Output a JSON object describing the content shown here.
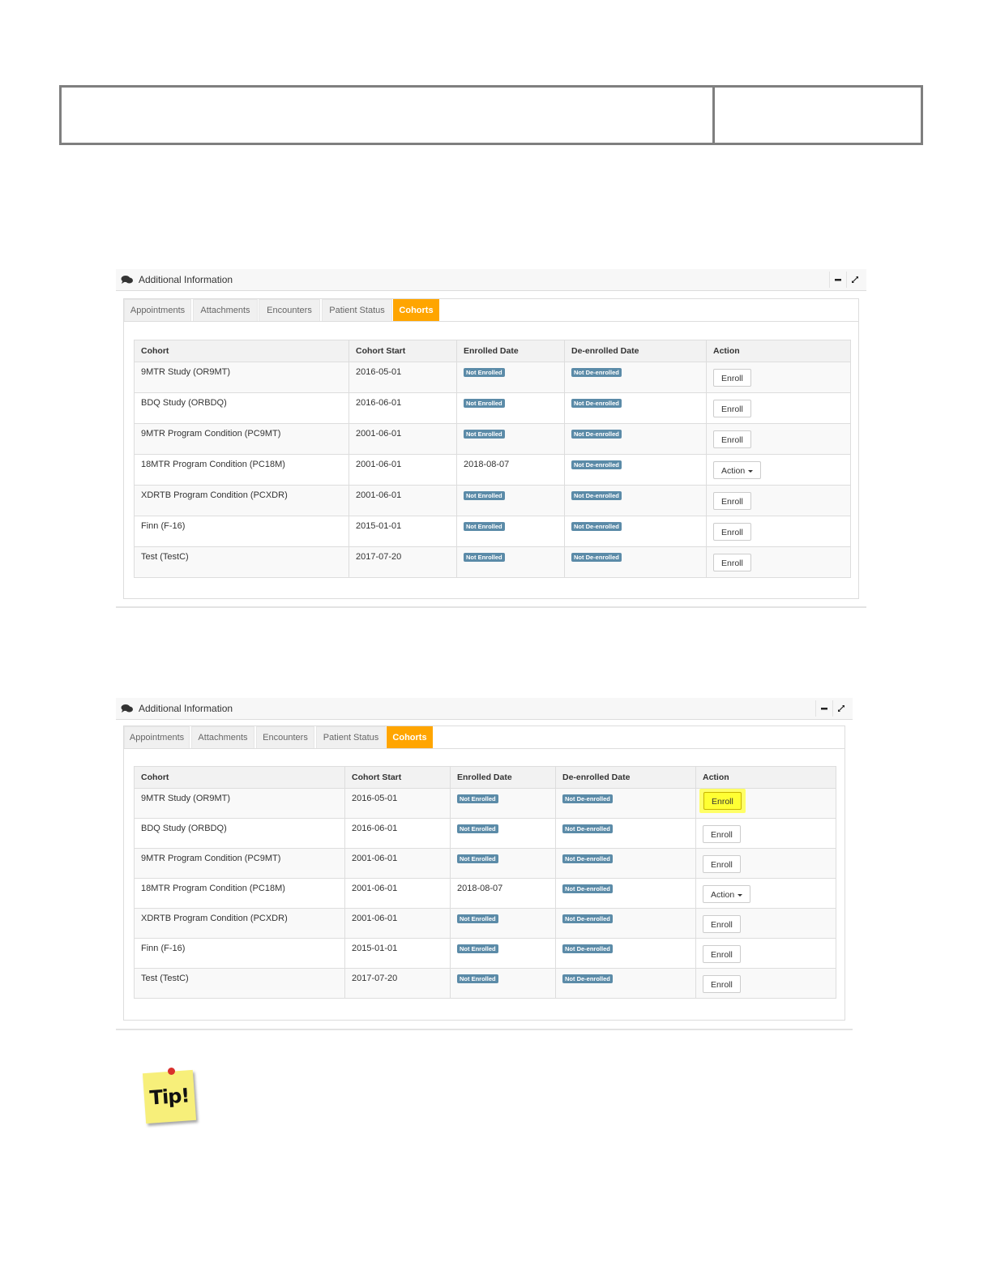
{
  "panel_title": "Additional Information",
  "tabs": [
    "Appointments",
    "Attachments",
    "Encounters",
    "Patient Status",
    "Cohorts"
  ],
  "active_tab": "Cohorts",
  "columns": [
    "Cohort",
    "Cohort Start",
    "Enrolled Date",
    "De-enrolled Date",
    "Action"
  ],
  "rows": [
    {
      "cohort": "9MTR Study (OR9MT)",
      "start": "2016-05-01",
      "enrolled": "Not Enrolled",
      "deenrolled": "Not De-enrolled",
      "action": "Enroll"
    },
    {
      "cohort": "BDQ Study (ORBDQ)",
      "start": "2016-06-01",
      "enrolled": "Not Enrolled",
      "deenrolled": "Not De-enrolled",
      "action": "Enroll"
    },
    {
      "cohort": "9MTR Program Condition (PC9MT)",
      "start": "2001-06-01",
      "enrolled": "Not Enrolled",
      "deenrolled": "Not De-enrolled",
      "action": "Enroll"
    },
    {
      "cohort": "18MTR Program Condition (PC18M)",
      "start": "2001-06-01",
      "enrolled": "2018-08-07",
      "deenrolled": "Not De-enrolled",
      "action": "Action"
    },
    {
      "cohort": "XDRTB Program Condition (PCXDR)",
      "start": "2001-06-01",
      "enrolled": "Not Enrolled",
      "deenrolled": "Not De-enrolled",
      "action": "Enroll"
    },
    {
      "cohort": "Finn (F-16)",
      "start": "2015-01-01",
      "enrolled": "Not Enrolled",
      "deenrolled": "Not De-enrolled",
      "action": "Enroll"
    },
    {
      "cohort": "Test (TestC)",
      "start": "2017-07-20",
      "enrolled": "Not Enrolled",
      "deenrolled": "Not De-enrolled",
      "action": "Enroll"
    }
  ],
  "tip_label": "Tip!",
  "colors": {
    "active_tab": "#ffa500",
    "badge": "#5b8ba8",
    "highlight": "#ffff33"
  }
}
